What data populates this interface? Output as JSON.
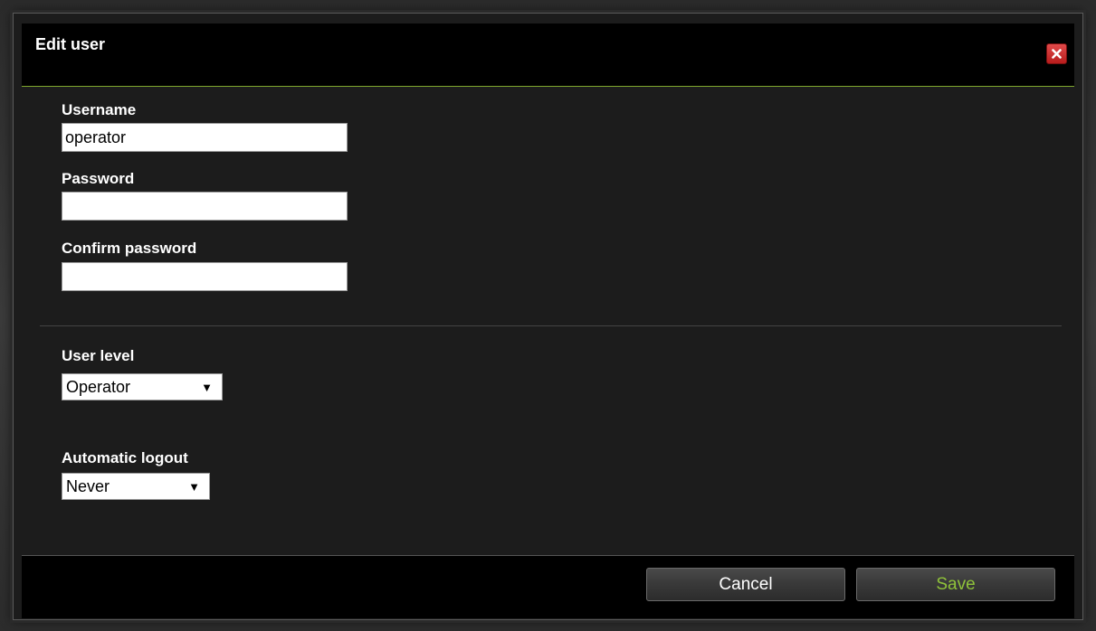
{
  "dialog": {
    "title": "Edit user",
    "close_icon": "close-x-icon"
  },
  "form": {
    "username": {
      "label": "Username",
      "value": "operator"
    },
    "password": {
      "label": "Password",
      "value": ""
    },
    "confirm_password": {
      "label": "Confirm password",
      "value": ""
    },
    "user_level": {
      "label": "User level",
      "selected": "Operator"
    },
    "automatic_logout": {
      "label": "Automatic logout",
      "selected": "Never"
    }
  },
  "footer": {
    "cancel_label": "Cancel",
    "save_label": "Save"
  },
  "colors": {
    "accent_green": "#8fc23a",
    "close_red": "#c82a2a",
    "background": "#1c1c1c"
  }
}
